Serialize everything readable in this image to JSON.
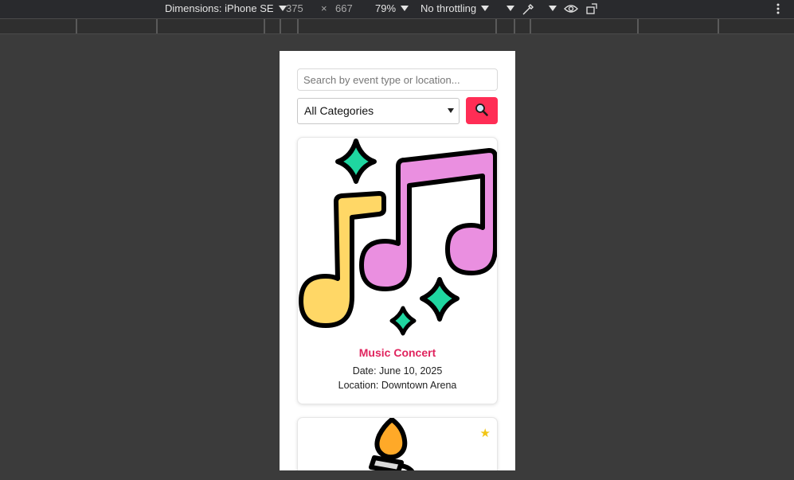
{
  "devtools": {
    "dimensions_label": "Dimensions: iPhone SE",
    "width": "375",
    "times": "×",
    "height": "667",
    "zoom": "79%",
    "throttling": "No throttling"
  },
  "search": {
    "placeholder": "Search by event type or location..."
  },
  "filter": {
    "selected_category": "All Categories"
  },
  "events": [
    {
      "title": "Music Concert",
      "date": "Date: June 10, 2025",
      "location": "Location: Downtown Arena",
      "favorite": "★"
    },
    {
      "favorite": "★"
    }
  ],
  "colors": {
    "accent": "#ff2d55",
    "title": "#e0245e",
    "star": "#f2c514"
  }
}
